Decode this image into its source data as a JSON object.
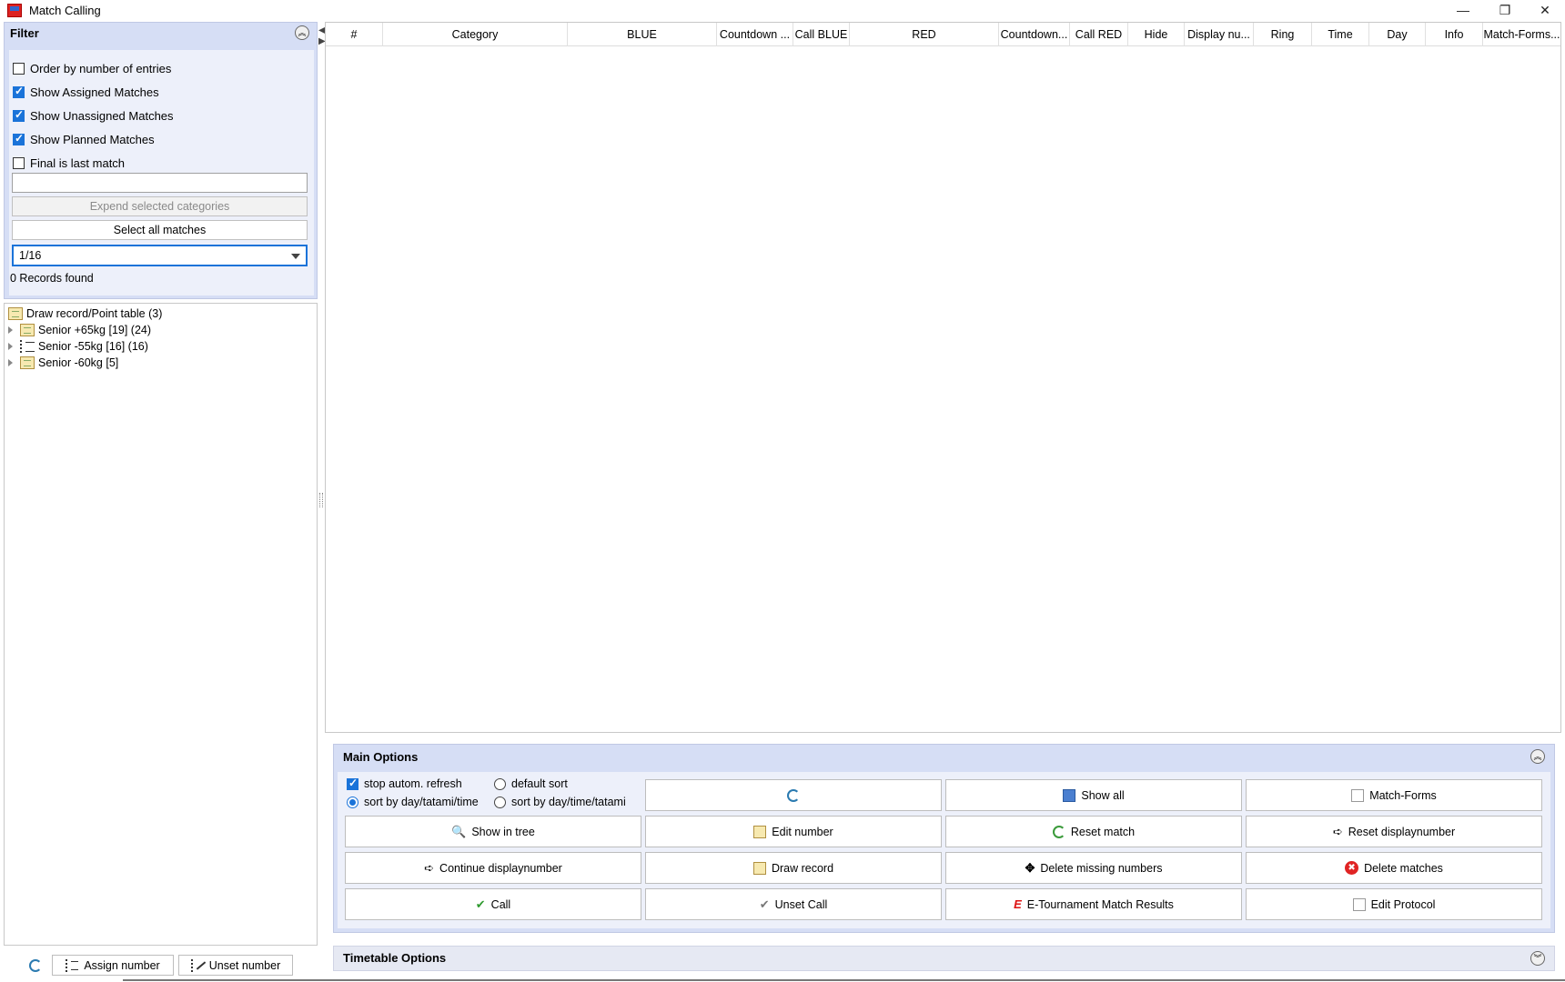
{
  "window": {
    "title": "Match Calling",
    "minimize": "—",
    "restore": "❐",
    "close": "✕"
  },
  "filter": {
    "title": "Filter",
    "collapse_glyph": "︽",
    "checkboxes": [
      {
        "label": "Order by number of entries",
        "checked": false
      },
      {
        "label": "Show Assigned Matches",
        "checked": true
      },
      {
        "label": "Show Unassigned Matches",
        "checked": true
      },
      {
        "label": "Show Planned Matches",
        "checked": true
      },
      {
        "label": "Final is last match",
        "checked": false
      }
    ],
    "search_value": "",
    "expend_button": "Expend selected categories",
    "select_all_button": "Select all matches",
    "round_select": "1/16",
    "records_found": "0 Records found"
  },
  "tree": {
    "root": {
      "label": "Draw record/Point table (3)",
      "icon": "draw-record-icon"
    },
    "items": [
      {
        "label": "Senior +65kg [19] (24)",
        "icon": "draw-record-icon"
      },
      {
        "label": "Senior -55kg [16] (16)",
        "icon": "list-icon"
      },
      {
        "label": "Senior -60kg [5]",
        "icon": "draw-record-icon"
      }
    ]
  },
  "splitter": {
    "left_arrow": "◀",
    "right_arrow": "▶"
  },
  "bottom_left": {
    "refresh_icon": "refresh-icon",
    "assign_number": "Assign number",
    "unset_number": "Unset number"
  },
  "table": {
    "columns": [
      "#",
      "Category",
      "BLUE",
      "Countdown ...",
      "Call BLUE",
      "RED",
      "Countdown...",
      "Call RED",
      "Hide",
      "Display nu...",
      "Ring",
      "Time",
      "Day",
      "Info",
      "Match-Forms..."
    ],
    "rows": []
  },
  "main_options": {
    "title": "Main Options",
    "collapse_glyph": "︽",
    "stop_refresh": {
      "label": "stop autom. refresh",
      "checked": true
    },
    "sort_options": [
      {
        "label": "sort by day/tatami/time",
        "checked": true
      },
      {
        "label": "default sort",
        "checked": false
      },
      {
        "label": "sort by day/time/tatami",
        "checked": false
      }
    ],
    "buttons": {
      "refresh": "",
      "show_all": "Show all",
      "match_forms": "Match-Forms",
      "show_in_tree": "Show in tree",
      "edit_number": "Edit number",
      "reset_match": "Reset match",
      "reset_displaynumber": "Reset displaynumber",
      "continue_displaynumber": "Continue displaynumber",
      "draw_record": "Draw record",
      "delete_missing_numbers": "Delete missing numbers",
      "delete_matches": "Delete matches",
      "call": "Call",
      "unset_call": "Unset Call",
      "e_tournament": "E-Tournament Match Results",
      "edit_protocol": "Edit Protocol"
    },
    "icons": {
      "check": "✔",
      "arrow": "➪",
      "delete": "✖",
      "search": "🔍"
    }
  },
  "timetable_options": {
    "title": "Timetable Options",
    "expand_glyph": "︾"
  },
  "colors": {
    "panel": "#d6def5",
    "panel_body": "#edf0fa",
    "accent": "#1a73d9"
  }
}
